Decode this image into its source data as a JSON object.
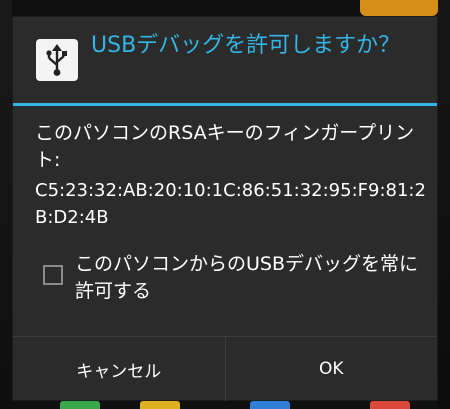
{
  "dialog": {
    "title": "USBデバッグを許可しますか？",
    "icon": "usb-icon",
    "message": "このパソコンのRSAキーのフィンガープリント:",
    "fingerprint": "C5:23:32:AB:20:10:1C:86:51:32:95:F9:81:2B:D2:4B",
    "checkbox": {
      "label": "このパソコンからのUSBデバッグを常に許可する",
      "checked": false
    },
    "buttons": {
      "cancel_label": "キャンセル",
      "ok_label": "OK"
    }
  },
  "colors": {
    "accent": "#33b5e5",
    "dialog_background": "#2b2b2b",
    "text": "#ffffff"
  }
}
